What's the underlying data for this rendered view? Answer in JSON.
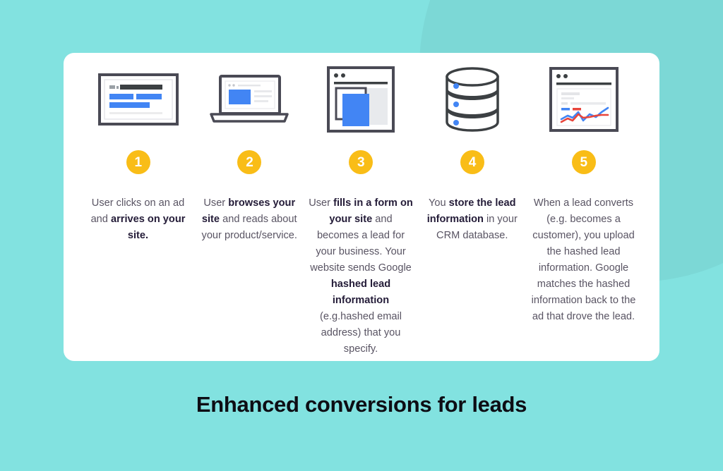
{
  "theme": {
    "background_color": "#82e2e0",
    "blob_color": "#7cd8d6",
    "card_color": "#ffffff",
    "badge_color": "#f9bd17",
    "badge_text_color": "#ffffff",
    "accent_blue": "#4285f4",
    "accent_red": "#e8453c",
    "body_text_color": "#595463",
    "bold_text_color": "#241c38",
    "title_color": "#0d0d14"
  },
  "title": "Enhanced conversions for leads",
  "steps": [
    {
      "number": "1",
      "icon": "search-ad-result-icon",
      "text_html": "User clicks on an ad and <b>arrives on your site.</b>",
      "text_plain": "User clicks on an ad and arrives on your site."
    },
    {
      "number": "2",
      "icon": "laptop-website-icon",
      "text_html": "User <b>browses your site</b> and reads about your product/service.",
      "text_plain": "User browses your site and reads about your product/service."
    },
    {
      "number": "3",
      "icon": "browser-form-window-icon",
      "text_html": "User <b>fills in a form on your site</b> and becomes a lead for your business. Your website sends Google <b>hashed lead information</b> (e.g.hashed email address) that you specify.",
      "text_plain": "User fills in a form on your site and becomes a lead for your business. Your website sends Google hashed lead information (e.g.hashed email address) that you specify."
    },
    {
      "number": "4",
      "icon": "database-icon",
      "text_html": "You <b>store the lead information</b> in your CRM database.",
      "text_plain": "You store the lead information in your CRM database."
    },
    {
      "number": "5",
      "icon": "analytics-chart-window-icon",
      "text_html": "When a lead converts (e.g. becomes a customer), you upload the hashed lead information. Google matches the hashed information back to the ad that drove the lead.",
      "text_plain": "When a lead converts (e.g. becomes a customer), you upload the hashed lead information. Google matches the hashed information back to the ad that drove the lead."
    }
  ]
}
